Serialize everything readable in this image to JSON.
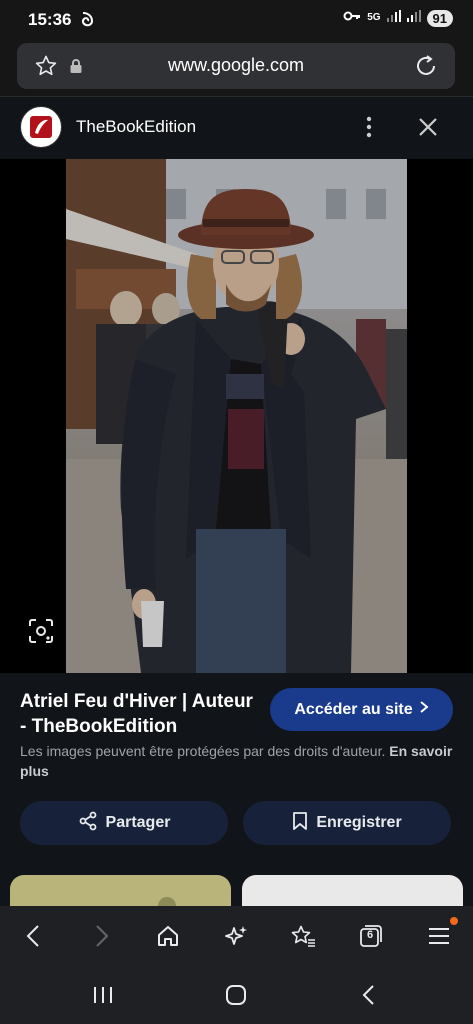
{
  "status_bar": {
    "time": "15:36",
    "network": "5G",
    "battery": "91"
  },
  "browser": {
    "url": "www.google.com",
    "tab_count": "6"
  },
  "result": {
    "site_name": "TheBookEdition",
    "title": "Atriel Feu d'Hiver | Auteur - TheBookEdition",
    "visit_label": "Accéder au site",
    "copyright_text": "Les images peuvent être protégées par des droits d'auteur.",
    "learn_more": "En savoir plus",
    "share_label": "Partager",
    "save_label": "Enregistrer"
  },
  "icons": {
    "bookmark": "star-icon",
    "lock": "lock-icon",
    "reload": "reload-icon",
    "menu": "more-vert-icon",
    "close": "close-icon",
    "lens": "lens-icon"
  },
  "colors": {
    "accent_button": "#1a3a8c",
    "pill_button": "#17223a",
    "background": "#111418"
  }
}
